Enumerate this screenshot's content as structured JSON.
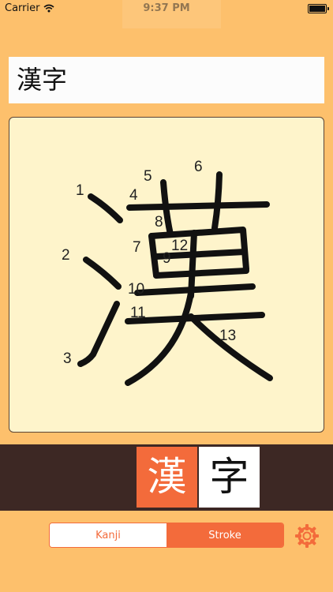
{
  "status_bar": {
    "carrier": "Carrier",
    "time": "9:37 PM",
    "wifi_icon": "wifi-icon",
    "battery_icon": "battery-icon"
  },
  "input": {
    "value": "漢字"
  },
  "stroke_panel": {
    "character": "漢",
    "stroke_numbers": [
      "1",
      "2",
      "3",
      "4",
      "5",
      "6",
      "7",
      "8",
      "9",
      "10",
      "11",
      "12",
      "13"
    ]
  },
  "character_tiles": [
    {
      "char": "漢",
      "selected": true
    },
    {
      "char": "字",
      "selected": false
    }
  ],
  "mode_segment": {
    "kanji_label": "Kanji",
    "stroke_label": "Stroke",
    "selected": "Stroke"
  },
  "settings": {
    "icon": "gear-icon"
  },
  "colors": {
    "background": "#fdc06c",
    "accent": "#f36b3b",
    "panel": "#fef4cb",
    "dark_bar": "#3d2824"
  }
}
